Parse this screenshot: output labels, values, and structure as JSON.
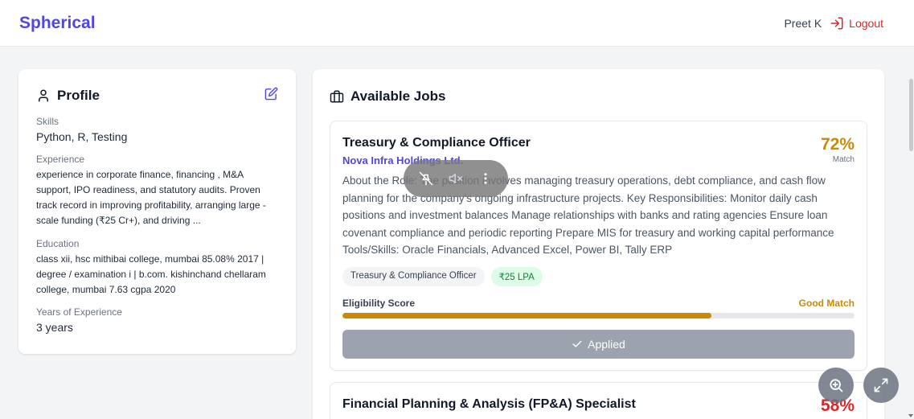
{
  "header": {
    "brand": "Spherical",
    "user_name": "Preet K",
    "logout_label": "Logout"
  },
  "profile": {
    "title": "Profile",
    "skills_label": "Skills",
    "skills_value": "Python, R, Testing",
    "experience_label": "Experience",
    "experience_value": "experience in corporate finance, financing , M&A support, IPO readiness, and statutory audits. Proven track record in improving profitability, arranging large -scale funding (₹25 Cr+), and driving ...",
    "education_label": "Education",
    "education_value": "class xii, hsc mithibai college, mumbai 85.08% 2017 | degree / examination i | b.com. kishinchand chellaram college, mumbai 7.63 cgpa 2020",
    "years_label": "Years of Experience",
    "years_value": "3 years"
  },
  "jobs": {
    "title": "Available Jobs",
    "list": [
      {
        "title": "Treasury & Compliance Officer",
        "company": "Nova Infra Holdings Ltd.",
        "match_pct": "72%",
        "match_label": "Match",
        "description": "About the Role: The position involves managing treasury operations, debt compliance, and cash flow planning for the company's ongoing infrastructure projects. Key Responsibilities: Monitor daily cash positions and investment balances Manage relationships with banks and rating agencies Ensure loan covenant compliance and periodic reporting Prepare MIS for treasury and working capital performance Tools/Skills: Oracle Financials, Advanced Excel, Power BI, Tally ERP",
        "tag_role": "Treasury & Compliance Officer",
        "tag_salary": "₹25 LPA",
        "eligibility_label": "Eligibility Score",
        "eligibility_status": "Good Match",
        "eligibility_score": 0.72,
        "button_label": "Applied"
      },
      {
        "title": "Financial Planning & Analysis (FP&A) Specialist",
        "match_pct": "58%"
      }
    ]
  },
  "colors": {
    "brand": "#4f46e5",
    "match_good": "#ca8a04",
    "match_low": "#dc2626",
    "logout": "#dc2626",
    "salary_tag_bg": "#dcfce7"
  }
}
